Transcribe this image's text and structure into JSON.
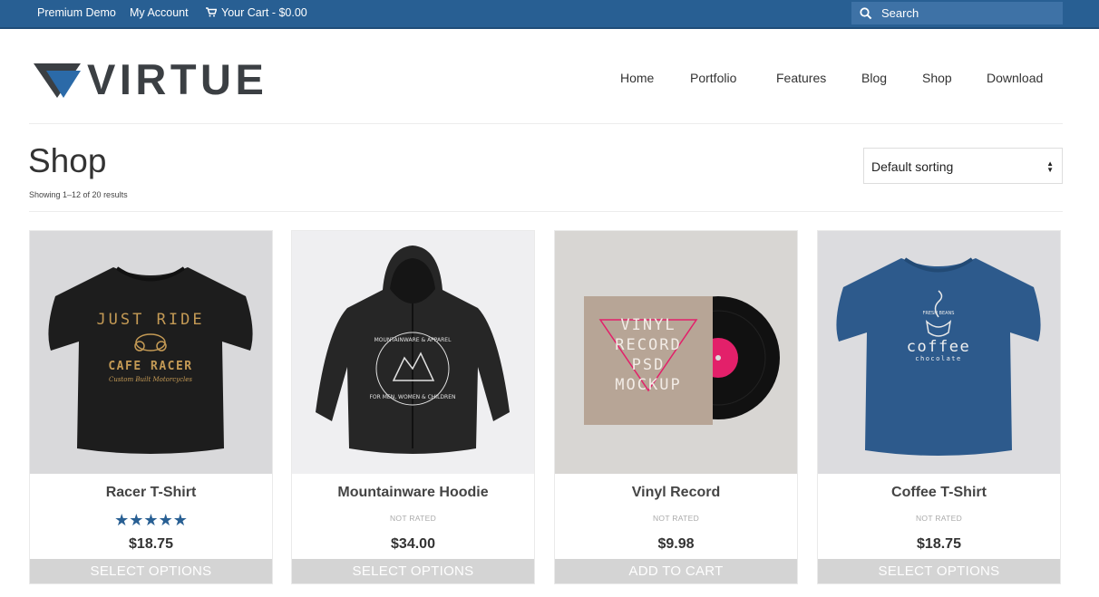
{
  "topbar": {
    "links": [
      "Premium Demo",
      "My Account"
    ],
    "cart_label": "Your Cart - $0.00",
    "search_placeholder": "Search"
  },
  "logo": {
    "text": "VIRTUE"
  },
  "nav": [
    "Home",
    "Portfolio",
    "Features",
    "Blog",
    "Shop",
    "Download"
  ],
  "shop": {
    "title": "Shop",
    "result_count": "Showing 1–12 of 20 results",
    "sort": {
      "selected": "Default sorting"
    }
  },
  "products": [
    {
      "name": "Racer T-Shirt",
      "rating": "★★★★★",
      "rating_value": 5,
      "price": "$18.75",
      "button": "Select Options",
      "image": "black-tshirt-just-ride-cafe-racer"
    },
    {
      "name": "Mountainware Hoodie",
      "rating": "NOT RATED",
      "price": "$34.00",
      "button": "Select Options",
      "image": "black-hoodie-mountainware"
    },
    {
      "name": "Vinyl Record",
      "rating": "NOT RATED",
      "price": "$9.98",
      "button": "Add to cart",
      "image": "vinyl-record-psd-mockup"
    },
    {
      "name": "Coffee T-Shirt",
      "rating": "NOT RATED",
      "price": "$18.75",
      "button": "Select Options",
      "image": "blue-tshirt-coffee-chocolate"
    }
  ],
  "image_text": {
    "racer_top": "JUST RIDE",
    "racer_main": "CAFE RACER",
    "racer_sub": "Custom Built Motorcycles",
    "hoodie_top": "MOUNTAINWARE & APPAREL",
    "hoodie_bottom": "FOR MEN, WOMEN & CHILDREN",
    "vinyl_lines": [
      "VINYL",
      "RECORD",
      "PSD",
      "MOCKUP"
    ],
    "coffee_top": "FRESH BEANS",
    "coffee_main": "coffee",
    "coffee_sub": "chocolate"
  },
  "colors": {
    "topbar": "#285f93",
    "accent": "#285f93",
    "button_bg": "#d4d4d4",
    "logo_dark": "#3b3f43",
    "logo_blue": "#2b6aa8"
  }
}
